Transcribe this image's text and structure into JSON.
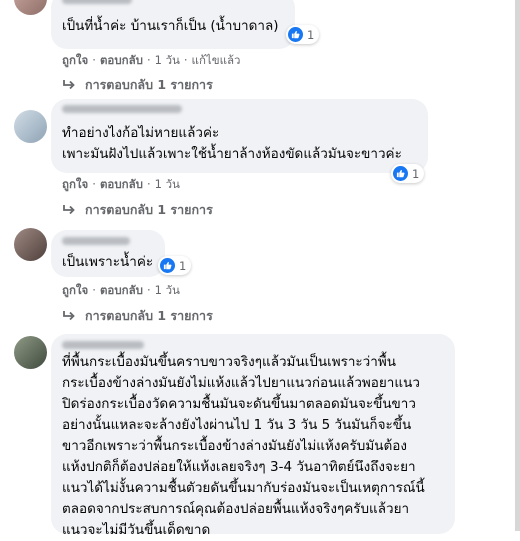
{
  "comments": [
    {
      "text": "เป็นที่น้ำค่ะ บ้านเราก็เป็น (น้ำบาดาล)",
      "reaction": {
        "icon": "like-icon",
        "count": "1"
      },
      "actions": {
        "like": "ถูกใจ",
        "reply": "ตอบกลับ",
        "time": "1 วัน",
        "edited": "แก้ไขแล้ว"
      },
      "replies": "การตอบกลับ 1 รายการ"
    },
    {
      "text": "ทำอย่างไงก้อไม่หายแล้วค่ะ\nเพาะมันฝังไปแล้วเพาะใช้น้ำยาล้างห้องขัดแล้วมันจะขาวค่ะ",
      "reaction": {
        "icon": "like-icon",
        "count": "1"
      },
      "actions": {
        "like": "ถูกใจ",
        "reply": "ตอบกลับ",
        "time": "1 วัน"
      },
      "replies": "การตอบกลับ 1 รายการ"
    },
    {
      "text": "เป็นเพราะน้ำค่ะ",
      "reaction": {
        "icon": "like-icon",
        "count": "1"
      },
      "actions": {
        "like": "ถูกใจ",
        "reply": "ตอบกลับ",
        "time": "1 วัน"
      },
      "replies": "การตอบกลับ 1 รายการ"
    },
    {
      "text": "ที่พื้นกระเบื้องมันขึ้นคราบขาวจริงๆแล้วมันเป็นเพราะว่าพื้น\nกระเบื้องข้างล่างมันยังไม่แห้งแล้วไปยาแนวก่อนแล้วพอยาแนว\nปิดร่องกระเบื้องวัดความชื้นมันจะดันขึ้นมาตลอดมันจะขึ้นขาว\nอย่างนั้นแหละจะล้างยังไงผ่านไป 1 วัน 3 วัน 5 วันมันก็จะขึ้น\nขาวอีกเพราะว่าพื้นกระเบื้องข้างล่างมันยังไม่แห้งครับมันต้อง\nแห้งปกติก็ต้องปล่อยให้แห้งเลยจริงๆ 3-4 วันอาทิตย์นึงถึงจะยา\nแนวได้ไม่งั้นความชื้นตัวยดันขึ้นมากับร่องมันจะเป็นเหตุการณ์นี้\nตลอดจากประสบการณ์คุณต้องปล่อยพื้นแห้งจริงๆครับแล้วยา\nแนวจะไม่มีวันขึ้นเด็ดขาด"
    }
  ]
}
